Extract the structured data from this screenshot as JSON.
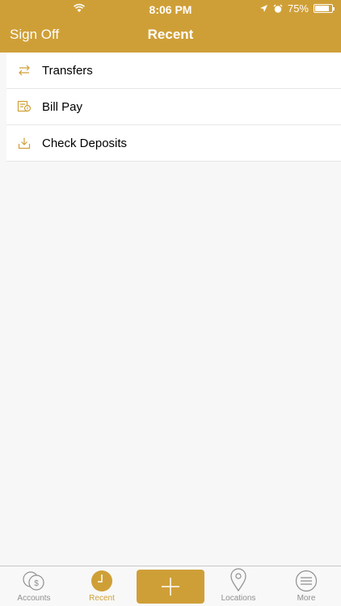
{
  "status": {
    "time": "8:06 PM",
    "battery": "75%"
  },
  "nav": {
    "left_button": "Sign Off",
    "title": "Recent"
  },
  "list": {
    "items": [
      {
        "label": "Transfers",
        "icon": "transfer-arrows-icon"
      },
      {
        "label": "Bill Pay",
        "icon": "bill-pay-icon"
      },
      {
        "label": "Check Deposits",
        "icon": "download-tray-icon"
      }
    ]
  },
  "tabs": [
    {
      "label": "Accounts",
      "icon": "accounts-coins-icon",
      "active": false
    },
    {
      "label": "Recent",
      "icon": "clock-icon",
      "active": true
    },
    {
      "label": "",
      "icon": "plus-icon"
    },
    {
      "label": "Locations",
      "icon": "location-pin-icon",
      "active": false
    },
    {
      "label": "More",
      "icon": "menu-icon",
      "active": false
    }
  ],
  "colors": {
    "accent": "#cf9f37",
    "background": "#f7f7f7",
    "inactive": "#8f8f8f"
  }
}
